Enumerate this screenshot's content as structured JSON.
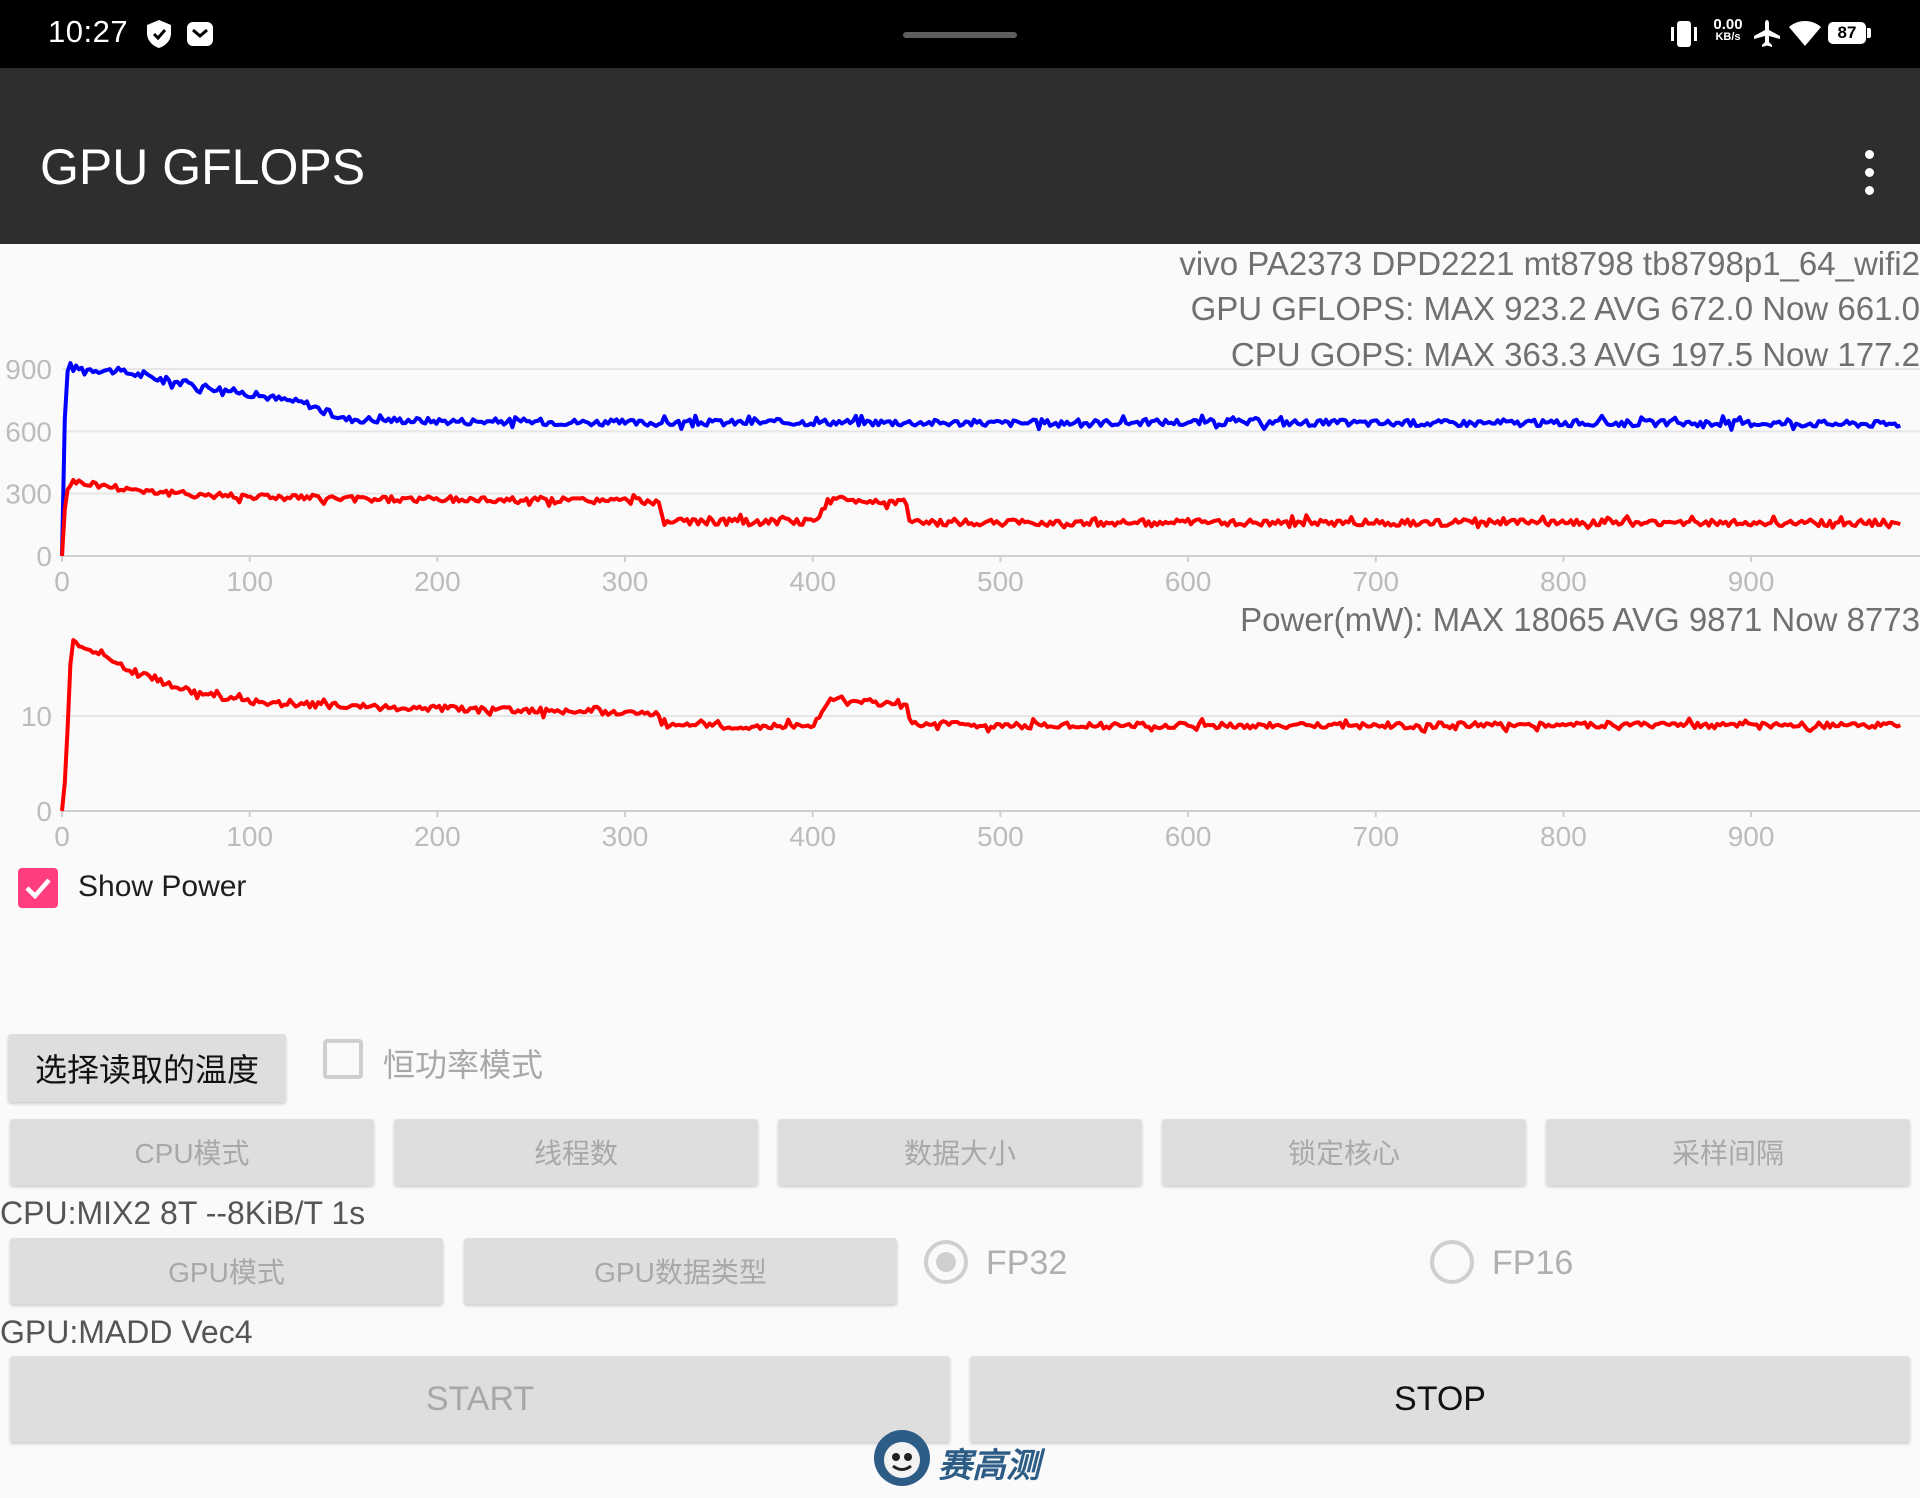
{
  "status_bar": {
    "time": "10:27",
    "net_speed": "0.00",
    "net_unit": "KB/s",
    "battery": "87"
  },
  "app_bar": {
    "title": "GPU GFLOPS"
  },
  "info": {
    "device": "vivo PA2373 DPD2221 mt8798 tb8798p1_64_wifi2",
    "gpu_stats": "GPU GFLOPS: MAX 923.2 AVG 672.0 Now 661.0",
    "cpu_stats": "CPU GOPS: MAX 363.3 AVG 197.5 Now 177.2",
    "power_stats": "Power(mW): MAX 18065 AVG 9871 Now 8773"
  },
  "chart_data": [
    {
      "type": "line",
      "x_ticks": [
        "0",
        "100",
        "200",
        "300",
        "400",
        "500",
        "600",
        "700",
        "800",
        "900"
      ],
      "y_ticks": [
        "0",
        "300",
        "600",
        "900"
      ],
      "xlim": [
        0,
        990
      ],
      "ylim": [
        0,
        900
      ],
      "grid": true,
      "series": [
        {
          "color": "#0000ff",
          "x": [
            0,
            2,
            5,
            30,
            60,
            100,
            130,
            150,
            200,
            270,
            310,
            400,
            500,
            600,
            700,
            800,
            900,
            980
          ],
          "y": [
            0,
            880,
            905,
            890,
            840,
            780,
            735,
            660,
            650,
            645,
            640,
            645,
            640,
            645,
            640,
            640,
            640,
            635
          ]
        },
        {
          "color": "#ff0000",
          "x": [
            0,
            2,
            5,
            30,
            60,
            150,
            250,
            318,
            320,
            400,
            410,
            450,
            452,
            500,
            600,
            700,
            800,
            900,
            980
          ],
          "y": [
            0,
            300,
            360,
            330,
            300,
            275,
            270,
            265,
            165,
            165,
            270,
            260,
            160,
            160,
            162,
            160,
            162,
            160,
            160
          ]
        }
      ]
    },
    {
      "type": "line",
      "x_ticks": [
        "0",
        "100",
        "200",
        "300",
        "400",
        "500",
        "600",
        "700",
        "800",
        "900"
      ],
      "y_ticks": [
        "0",
        "10"
      ],
      "xlim": [
        0,
        990
      ],
      "ylim": [
        0,
        18
      ],
      "grid": true,
      "series": [
        {
          "color": "#ff0000",
          "x": [
            0,
            2,
            5,
            15,
            40,
            70,
            100,
            150,
            200,
            250,
            318,
            320,
            400,
            410,
            450,
            452,
            500,
            600,
            700,
            800,
            900,
            980
          ],
          "y": [
            0,
            4,
            18,
            17,
            14.5,
            12.5,
            11.5,
            11,
            10.8,
            10.6,
            10.3,
            9,
            8.9,
            12,
            11,
            9.2,
            9,
            9,
            9,
            9.1,
            9,
            9
          ]
        }
      ]
    }
  ],
  "controls": {
    "show_power_label": "Show Power",
    "show_power_checked": true,
    "temp_button": "选择读取的温度",
    "const_power_label": "恒功率模式",
    "const_power_checked": false,
    "cpu_buttons": [
      "CPU模式",
      "线程数",
      "数据大小",
      "锁定核心",
      "采样间隔"
    ],
    "cpu_status": "CPU:MIX2 8T --8KiB/T 1s",
    "gpu_mode_button": "GPU模式",
    "gpu_type_button": "GPU数据类型",
    "fp32_label": "FP32",
    "fp16_label": "FP16",
    "selected_precision": "FP32",
    "gpu_status": "GPU:MADD Vec4",
    "start_button": "START",
    "stop_button": "STOP"
  },
  "watermark": {
    "text": "赛高测"
  }
}
